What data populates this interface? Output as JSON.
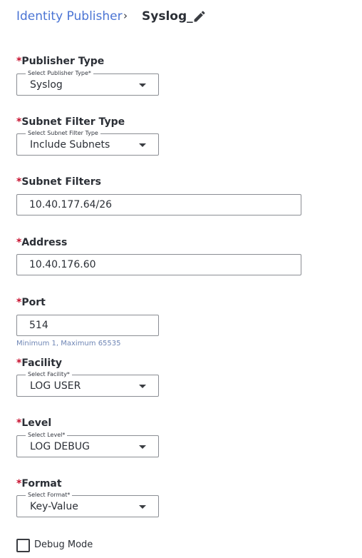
{
  "breadcrumb": {
    "parent": "Identity Publisher",
    "separator": "›",
    "current": "Syslog_"
  },
  "required_marker": "*",
  "fields": {
    "publisher_type": {
      "label": "Publisher Type",
      "legend": "Select Publisher Type*",
      "value": "Syslog"
    },
    "subnet_filter_type": {
      "label": "Subnet Filter Type",
      "legend": "Select Subnet Filter Type",
      "value": "Include Subnets"
    },
    "subnet_filters": {
      "label": "Subnet Filters",
      "value": "10.40.177.64/26"
    },
    "address": {
      "label": "Address",
      "value": "10.40.176.60"
    },
    "port": {
      "label": "Port",
      "value": "514",
      "hint": "Minimum 1, Maximum 65535"
    },
    "facility": {
      "label": "Facility",
      "legend": "Select Facility*",
      "value": "LOG USER"
    },
    "level": {
      "label": "Level",
      "legend": "Select Level*",
      "value": "LOG DEBUG"
    },
    "format": {
      "label": "Format",
      "legend": "Select Format*",
      "value": "Key-Value"
    }
  },
  "debug_mode": {
    "label": "Debug Mode",
    "checked": false
  },
  "colors": {
    "link": "#4a74d4",
    "required": "#c8102e",
    "border": "#8a8d93",
    "hint": "#6f86b5"
  },
  "icons": {
    "edit": "pencil-icon",
    "dropdown": "chevron-down-icon"
  }
}
